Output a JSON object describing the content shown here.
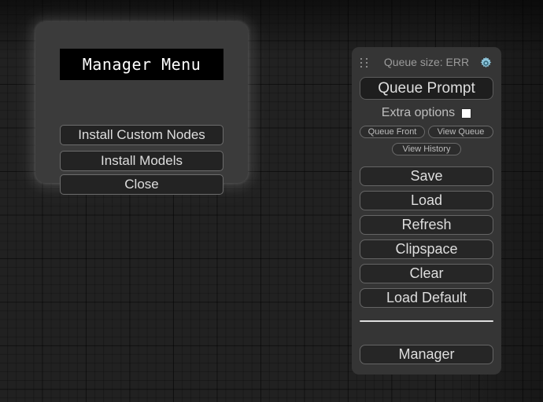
{
  "canvas": {
    "background_color": "#212121",
    "grid_line_color": "#000000"
  },
  "manager_dialog": {
    "title": "Manager Menu",
    "buttons": [
      {
        "label": "Install Custom Nodes",
        "name": "install-custom-nodes-button"
      },
      {
        "label": "Install Models",
        "name": "install-models-button"
      },
      {
        "label": "Close",
        "name": "close-button"
      }
    ]
  },
  "menu_panel": {
    "drag_handle_icon": "drag-dots-icon",
    "queue_size_label": "Queue size: ERR",
    "settings_gear_icon": "gear-icon",
    "settings_gear_color": "#8fc7dd",
    "queue_prompt_label": "Queue Prompt",
    "extra_options": {
      "label": "Extra options",
      "checked": false
    },
    "mini_buttons": [
      {
        "label": "Queue Front",
        "name": "queue-front-button"
      },
      {
        "label": "View Queue",
        "name": "view-queue-button"
      },
      {
        "label": "View History",
        "name": "view-history-button"
      }
    ],
    "main_buttons": [
      {
        "label": "Save",
        "name": "save-button"
      },
      {
        "label": "Load",
        "name": "load-button"
      },
      {
        "label": "Refresh",
        "name": "refresh-button"
      },
      {
        "label": "Clipspace",
        "name": "clipspace-button"
      },
      {
        "label": "Clear",
        "name": "clear-button"
      },
      {
        "label": "Load Default",
        "name": "load-default-button"
      }
    ],
    "manager_label": "Manager"
  }
}
